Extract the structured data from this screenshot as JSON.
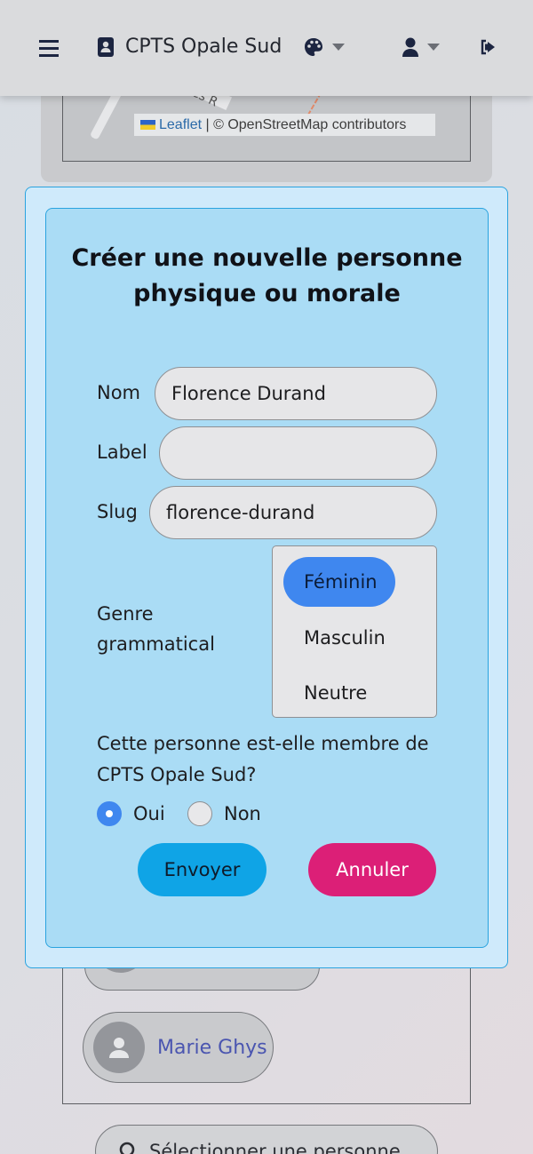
{
  "navbar": {
    "brand": "CPTS Opale Sud",
    "icons": [
      "menu-icon",
      "address-book-icon",
      "palette-icon",
      "user-icon",
      "logout-icon"
    ]
  },
  "map": {
    "street_fragment": "des R",
    "attribution_link": "Leaflet",
    "attribution_text": "| © OpenStreetMap contributors"
  },
  "modal": {
    "title": "Créer une nouvelle personne physique ou morale",
    "fields": {
      "nom": {
        "label": "Nom",
        "value": "Florence Durand"
      },
      "label": {
        "label": "Label",
        "value": ""
      },
      "slug": {
        "label": "Slug",
        "value": "florence-durand"
      }
    },
    "genre": {
      "label": "Genre grammatical",
      "options": [
        "Féminin",
        "Masculin",
        "Neutre"
      ],
      "selected": "Féminin"
    },
    "membership": {
      "question": "Cette personne est-elle membre de CPTS Opale Sud?",
      "options": [
        "Oui",
        "Non"
      ],
      "selected": "Oui"
    },
    "buttons": {
      "submit": "Envoyer",
      "cancel": "Annuler"
    }
  },
  "background_list": {
    "people": [
      "Marie Ghys"
    ],
    "select_person_placeholder": "Sélectionner une personne"
  },
  "colors": {
    "modal_bg": "#aadcf5",
    "modal_border": "#2aa3df",
    "selected_option": "#3f87ef",
    "submit_button": "#0fa4e6",
    "cancel_button": "#dc1f77",
    "link": "#4a55b0"
  }
}
